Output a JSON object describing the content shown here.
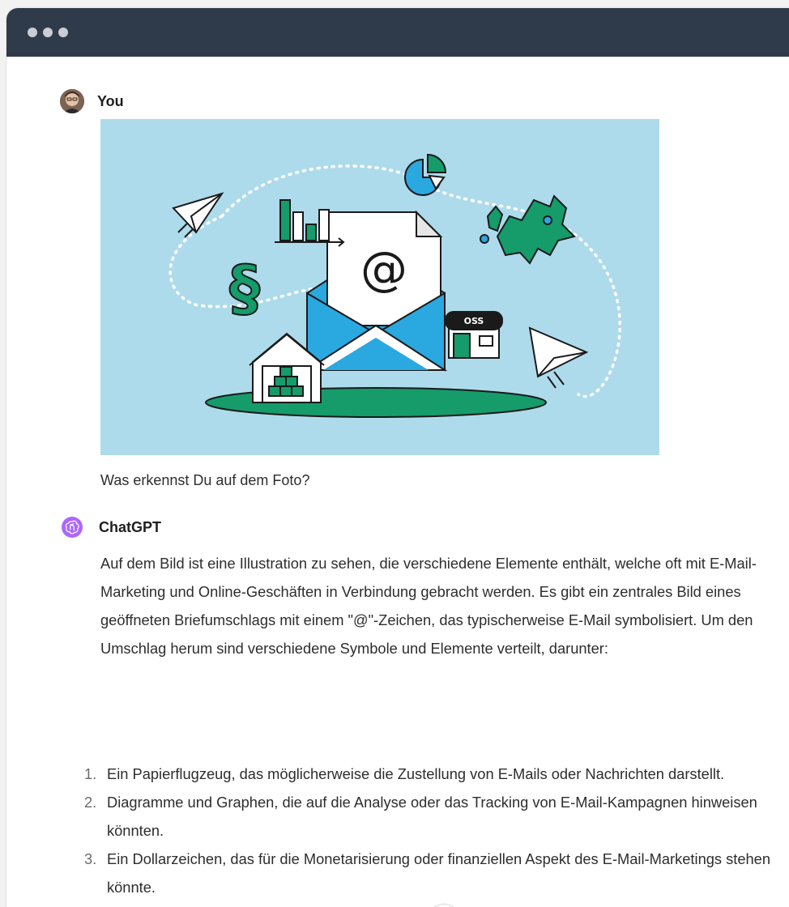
{
  "window": {
    "controls": [
      "close",
      "minimize",
      "zoom"
    ]
  },
  "user_message": {
    "author": "You",
    "text": "Was erkennst Du auf dem Foto?",
    "image": {
      "shop_sign": "OSS",
      "envelope_symbol": "@",
      "section_symbol": "§"
    }
  },
  "assistant_message": {
    "author": "ChatGPT",
    "paragraph": "Auf dem Bild ist eine Illustration zu sehen, die verschiedene Elemente enthält, welche oft mit E-Mail-Marketing und Online-Geschäften in Verbindung gebracht werden. Es gibt ein zentrales Bild eines geöffneten Briefumschlags mit einem \"@\"-Zeichen, das typischerweise E-Mail symbolisiert. Um den Umschlag herum sind verschiedene Symbole und Elemente verteilt, darunter:",
    "list": [
      {
        "num": "1.",
        "text": "Ein Papierflugzeug, das möglicherweise die Zustellung von E-Mails oder Nachrichten darstellt."
      },
      {
        "num": "2.",
        "text": "Diagramme und Graphen, die auf die Analyse oder das Tracking von E-Mail-Kampagnen hinweisen könnten."
      },
      {
        "num": "3.",
        "text": "Ein Dollarzeichen, das für die Monetarisierung oder finanziellen Aspekt des E-Mail-Marketings stehen könnte."
      }
    ]
  },
  "colors": {
    "titlebar": "#2f3a4a",
    "image_bg": "#aedbeb",
    "green": "#169b6b",
    "blue": "#2aa8e0",
    "gpt_avatar": "#ab68ff"
  },
  "icons": {
    "scroll_down": "arrow-down-icon",
    "gpt_logo": "openai-logo-icon"
  }
}
